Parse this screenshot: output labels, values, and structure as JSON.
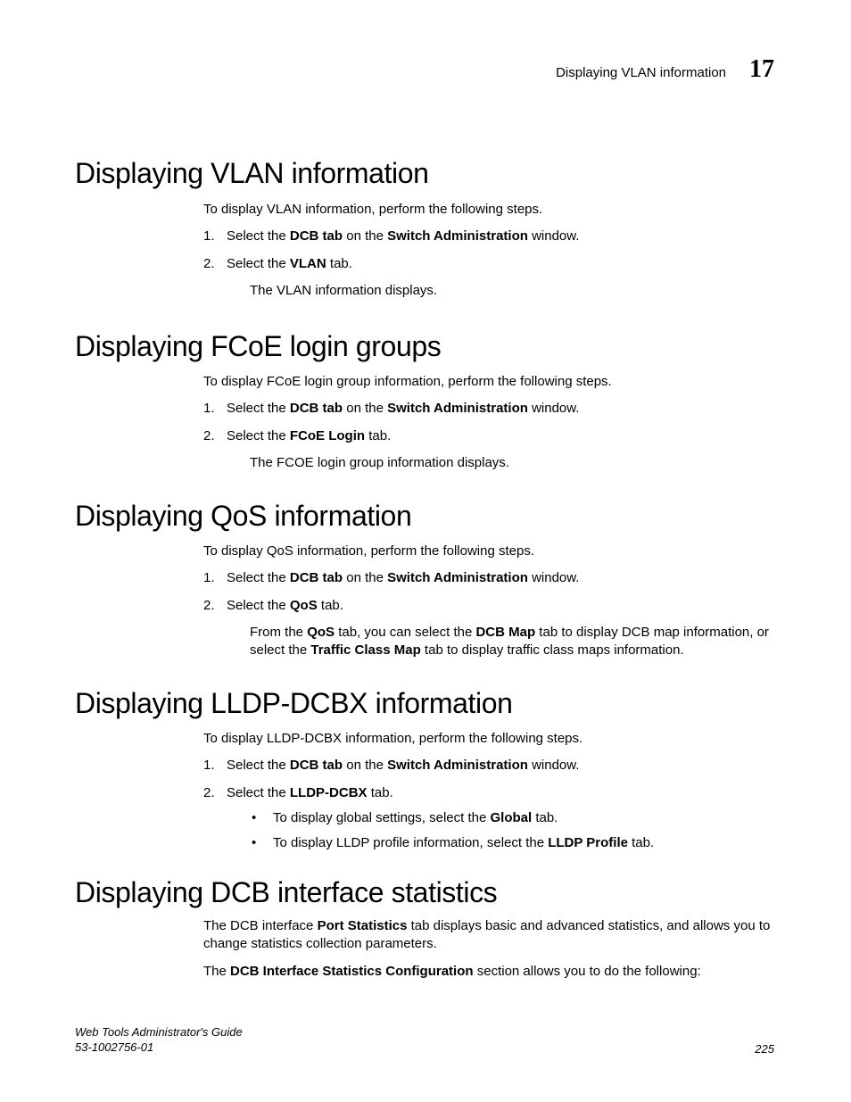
{
  "header": {
    "title": "Displaying VLAN information",
    "chapter_number": "17"
  },
  "sections": [
    {
      "heading": "Displaying VLAN information",
      "intro": "To display VLAN information, perform the following steps.",
      "steps": [
        {
          "num": "1.",
          "parts": [
            "Select the ",
            "DCB tab",
            " on the ",
            "Switch Administration",
            " window."
          ]
        },
        {
          "num": "2.",
          "parts": [
            "Select the ",
            "VLAN",
            " tab."
          ],
          "sub_plain": "The VLAN information displays."
        }
      ]
    },
    {
      "heading": "Displaying FCoE login groups",
      "intro": "To display FCoE login group information, perform the following steps.",
      "steps": [
        {
          "num": "1.",
          "parts": [
            "Select the ",
            "DCB tab",
            " on the ",
            "Switch Administration",
            " window."
          ]
        },
        {
          "num": "2.",
          "parts": [
            "Select the ",
            "FCoE Login",
            " tab."
          ],
          "sub_plain": "The FCOE login group information displays."
        }
      ]
    },
    {
      "heading": "Displaying QoS information",
      "intro": "To display QoS information, perform the following steps.",
      "steps": [
        {
          "num": "1.",
          "parts": [
            "Select the ",
            "DCB tab",
            " on the ",
            "Switch Administration",
            " window."
          ]
        },
        {
          "num": "2.",
          "parts": [
            "Select the ",
            "QoS",
            " tab."
          ],
          "sub_parts": [
            "From the ",
            "QoS",
            " tab, you can select the ",
            "DCB Map",
            " tab to display DCB map information, or select the ",
            "Traffic Class Map",
            " tab to display traffic class maps information."
          ]
        }
      ]
    },
    {
      "heading": "Displaying LLDP-DCBX information",
      "intro": "To display LLDP-DCBX information, perform the following steps.",
      "steps": [
        {
          "num": "1.",
          "parts": [
            "Select the ",
            "DCB tab",
            " on the ",
            "Switch Administration",
            " window."
          ]
        },
        {
          "num": "2.",
          "parts": [
            "Select the ",
            "LLDP-DCBX",
            " tab."
          ],
          "bullets": [
            {
              "parts": [
                "To display global settings, select the ",
                "Global",
                " tab."
              ]
            },
            {
              "parts": [
                "To display LLDP profile information, select the ",
                "LLDP Profile",
                " tab."
              ]
            }
          ]
        }
      ]
    },
    {
      "heading": "Displaying DCB interface statistics",
      "paragraphs": [
        {
          "parts": [
            "The DCB interface ",
            "Port Statistics",
            " tab displays basic and advanced statistics, and allows you to change statistics collection parameters."
          ]
        },
        {
          "parts": [
            "The ",
            "DCB Interface Statistics Configuration",
            " section allows you to do the following:"
          ]
        }
      ]
    }
  ],
  "footer": {
    "doc_title": "Web Tools Administrator's Guide",
    "doc_id": "53-1002756-01",
    "page_number": "225"
  },
  "layout": {
    "heading_tops": [
      176,
      370,
      560,
      770,
      982
    ],
    "body_tops": [
      225,
      418,
      608,
      818,
      1028
    ]
  }
}
